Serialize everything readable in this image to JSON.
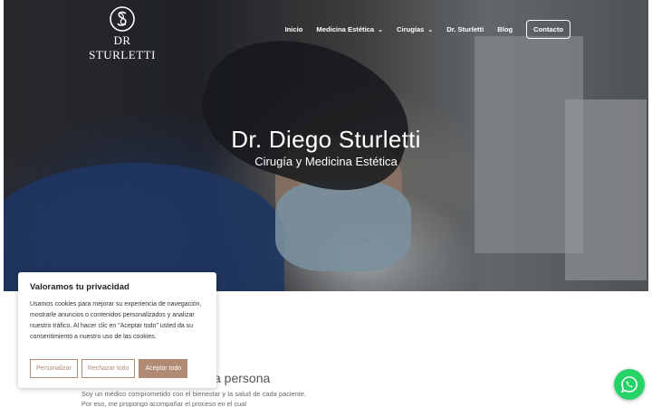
{
  "header": {
    "logo_text": "DR STURLETTI",
    "nav": [
      {
        "label": "Inicio",
        "has_dropdown": false
      },
      {
        "label": "Medicina Estética",
        "has_dropdown": true
      },
      {
        "label": "Cirugías",
        "has_dropdown": true
      },
      {
        "label": "Dr. Sturletti",
        "has_dropdown": false
      },
      {
        "label": "Blog",
        "has_dropdown": false
      }
    ],
    "cta_label": "Contacto"
  },
  "hero": {
    "title": "Dr. Diego Sturletti",
    "subtitle": "Cirugía y Medicina Estética"
  },
  "about": {
    "title_visible": "a persona",
    "body": "Soy un médico comprometido con el bienestar y la salud de cada paciente. Por eso, me propongo acompañar el proceso en el cual"
  },
  "cookie_banner": {
    "title": "Valoramos tu privacidad",
    "text": "Usamos cookies para mejorar su experiencia de navegación, mostrarle anuncios o contenidos personalizados y analizar nuestro tráfico. Al hacer clic en \"Aceptar todo\" usted da su consentimiento a nuestro uso de las cookies.",
    "customize_label": "Personalizar",
    "reject_label": "Rechazar todo",
    "accept_label": "Aceptar todo"
  },
  "colors": {
    "accent": "#b28a74",
    "whatsapp": "#25d366"
  },
  "icons": {
    "logo": "ds-monogram-icon",
    "chevron": "chevron-down-icon",
    "whatsapp": "whatsapp-icon"
  }
}
